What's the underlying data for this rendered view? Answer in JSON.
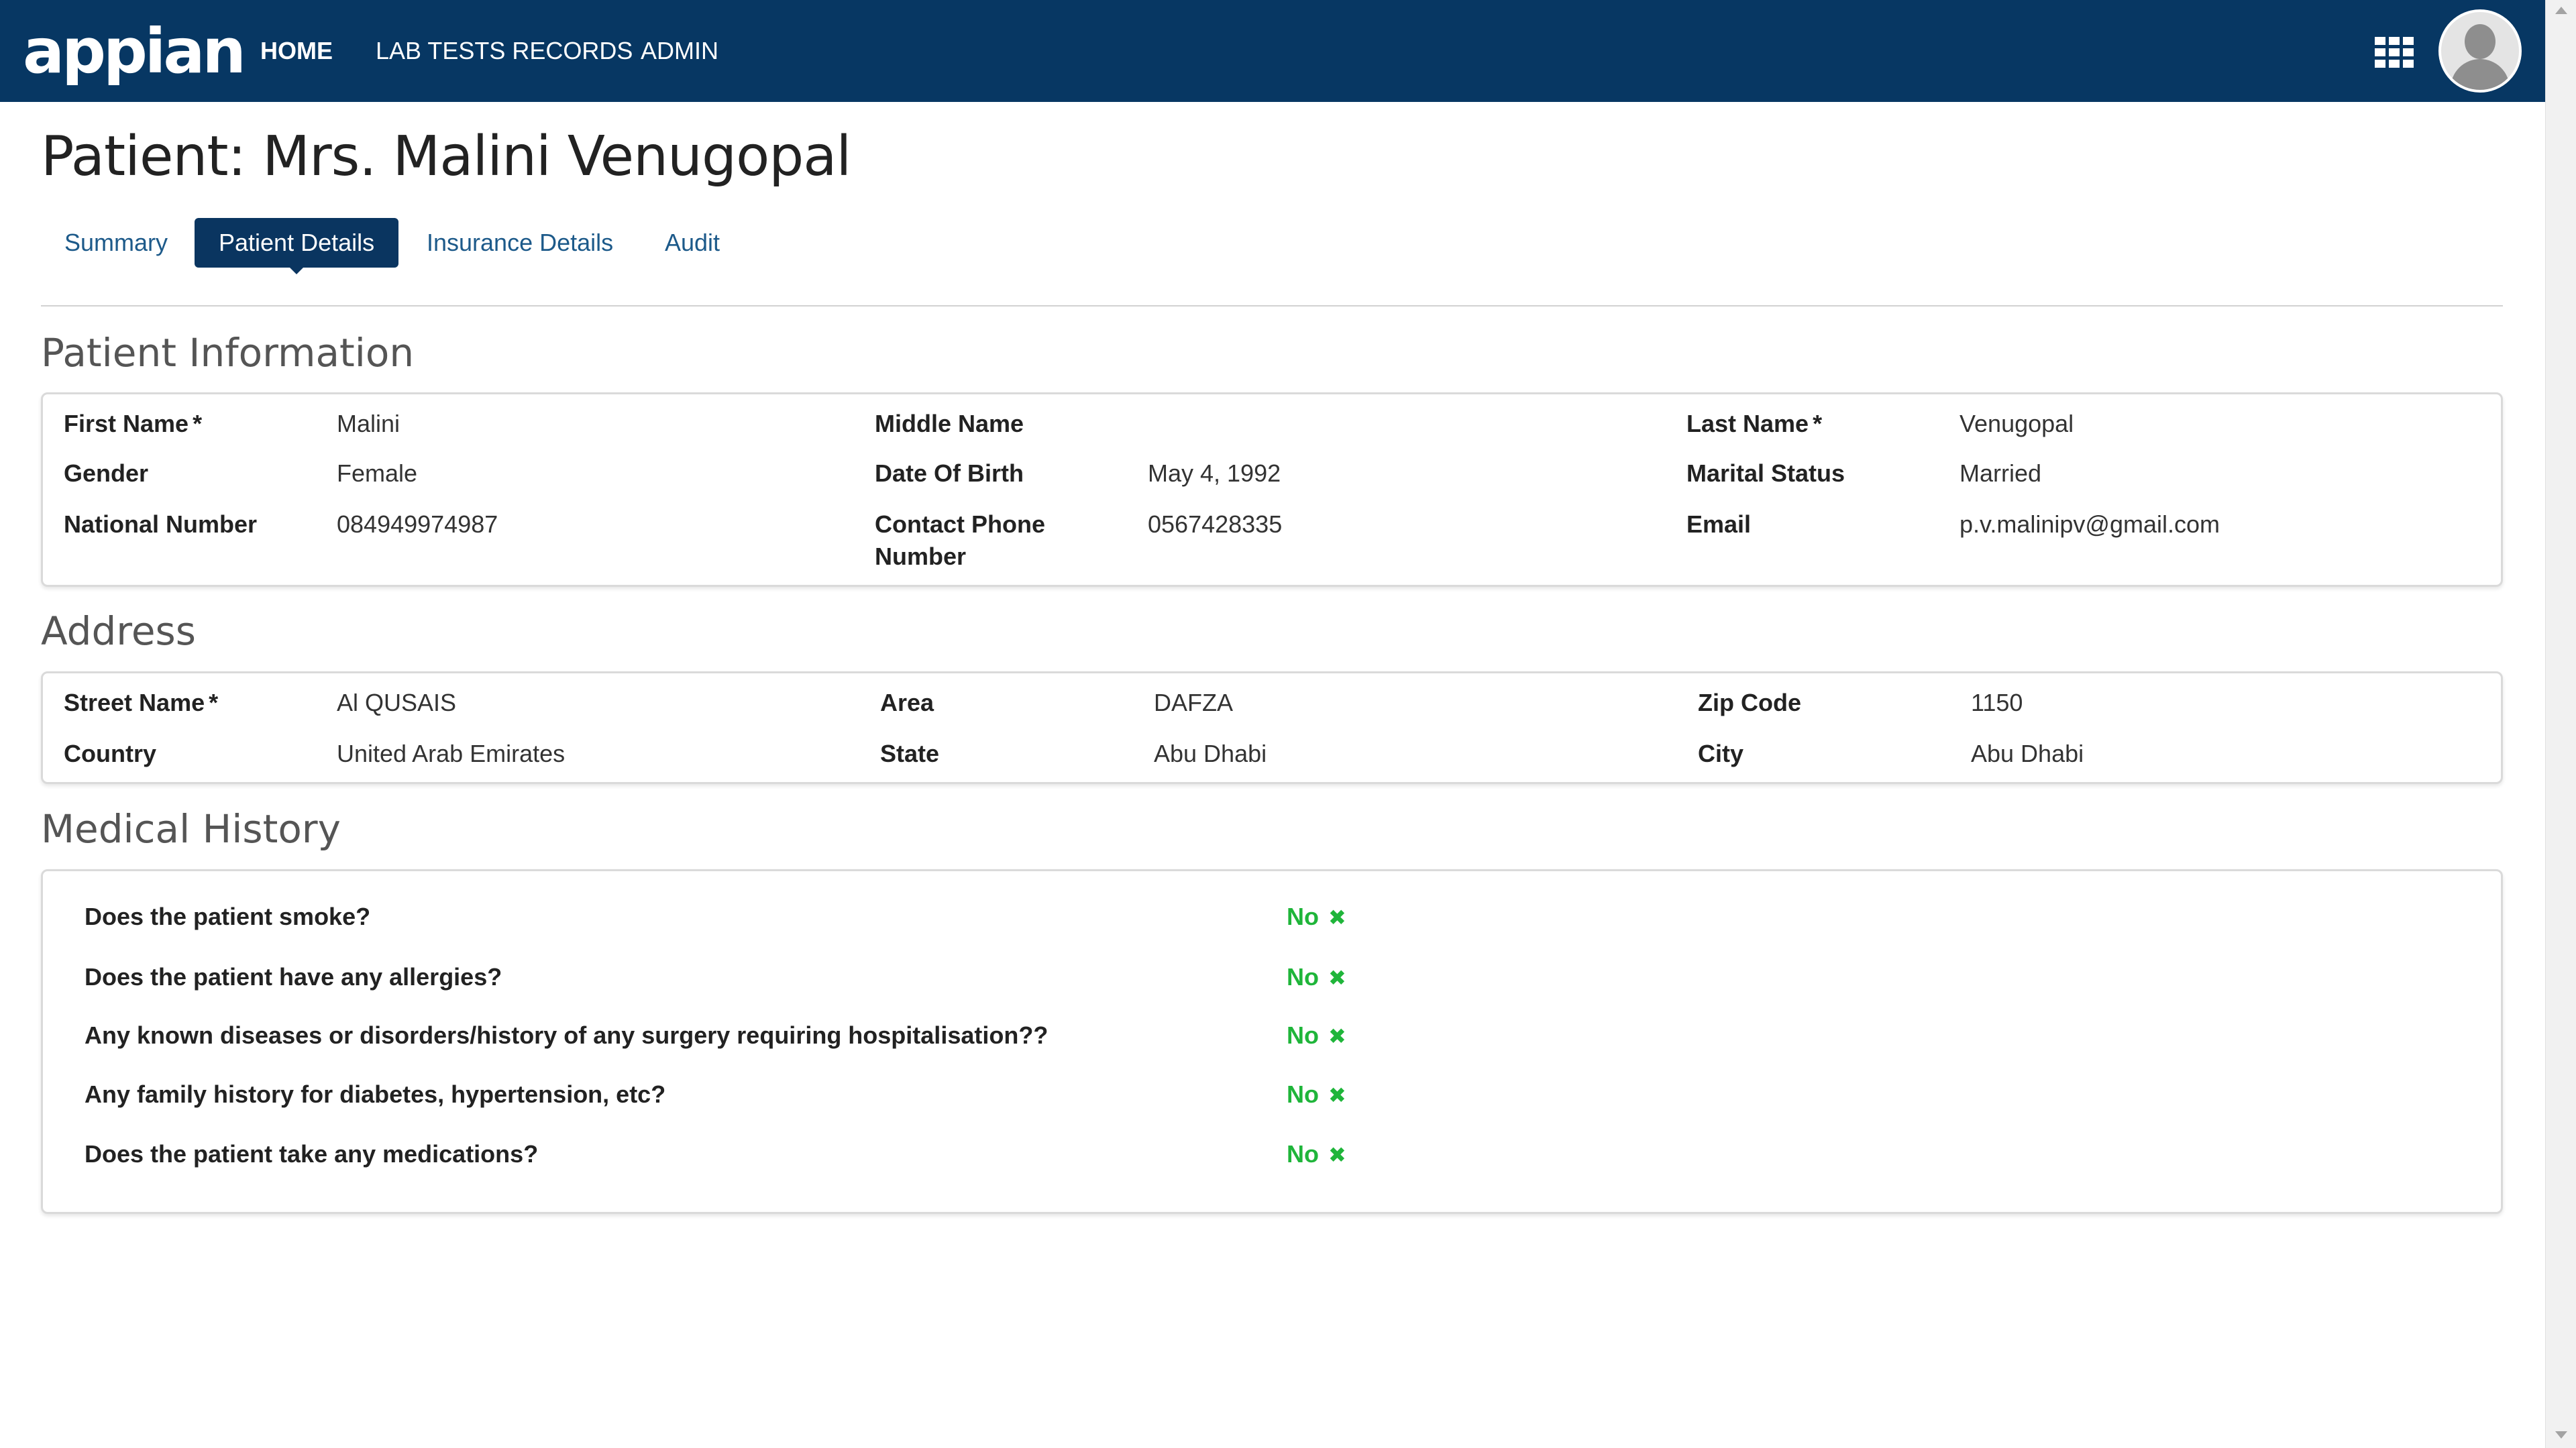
{
  "nav": {
    "logo": "appian",
    "home": "HOME",
    "lab_tests_records": "LAB TESTS RECORDS",
    "admin": "ADMIN"
  },
  "icons": {
    "apps_menu": "grid-icon",
    "user_avatar": "avatar-icon",
    "answer_no": "x-mark-icon"
  },
  "colors": {
    "nav_background": "#073763",
    "active_tab": "#0a3560",
    "tab_text": "#1d5a8a",
    "answer_green": "#1fb53a"
  },
  "page_title": "Patient: Mrs. Malini Venugopal",
  "tabs": [
    {
      "label": "Summary",
      "active": false
    },
    {
      "label": "Patient Details",
      "active": true
    },
    {
      "label": "Insurance Details",
      "active": false
    },
    {
      "label": "Audit",
      "active": false
    }
  ],
  "patient_information": {
    "title": "Patient Information",
    "required_marker": "*",
    "first_name_label": "First Name",
    "first_name": "Malini",
    "middle_name_label": "Middle Name",
    "middle_name": "",
    "last_name_label": "Last Name",
    "last_name": "Venugopal",
    "gender_label": "Gender",
    "gender": "Female",
    "dob_label": "Date Of Birth",
    "dob": "May 4, 1992",
    "marital_status_label": "Marital Status",
    "marital_status": "Married",
    "national_number_label": "National Number",
    "national_number": "084949974987",
    "contact_phone_label_line1": "Contact Phone",
    "contact_phone_label_line2": "Number",
    "contact_phone": "0567428335",
    "email_label": "Email",
    "email": "p.v.malinipv@gmail.com"
  },
  "address": {
    "title": "Address",
    "street_name_label": "Street Name",
    "street_name": "Al QUSAIS",
    "area_label": "Area",
    "area": "DAFZA",
    "zip_code_label": "Zip Code",
    "zip_code": "1150",
    "country_label": "Country",
    "country": "United Arab Emirates",
    "state_label": "State",
    "state": "Abu Dhabi",
    "city_label": "City",
    "city": "Abu Dhabi"
  },
  "medical_history": {
    "title": "Medical History",
    "questions": [
      {
        "question": "Does the patient smoke?",
        "answer": "No"
      },
      {
        "question": "Does the patient have any allergies?",
        "answer": "No"
      },
      {
        "question": "Any known diseases or disorders/history of any surgery requiring hospitalisation??",
        "answer": "No"
      },
      {
        "question": "Any family history for diabetes, hypertension, etc?",
        "answer": "No"
      },
      {
        "question": "Does the patient take any medications?",
        "answer": "No"
      }
    ]
  }
}
